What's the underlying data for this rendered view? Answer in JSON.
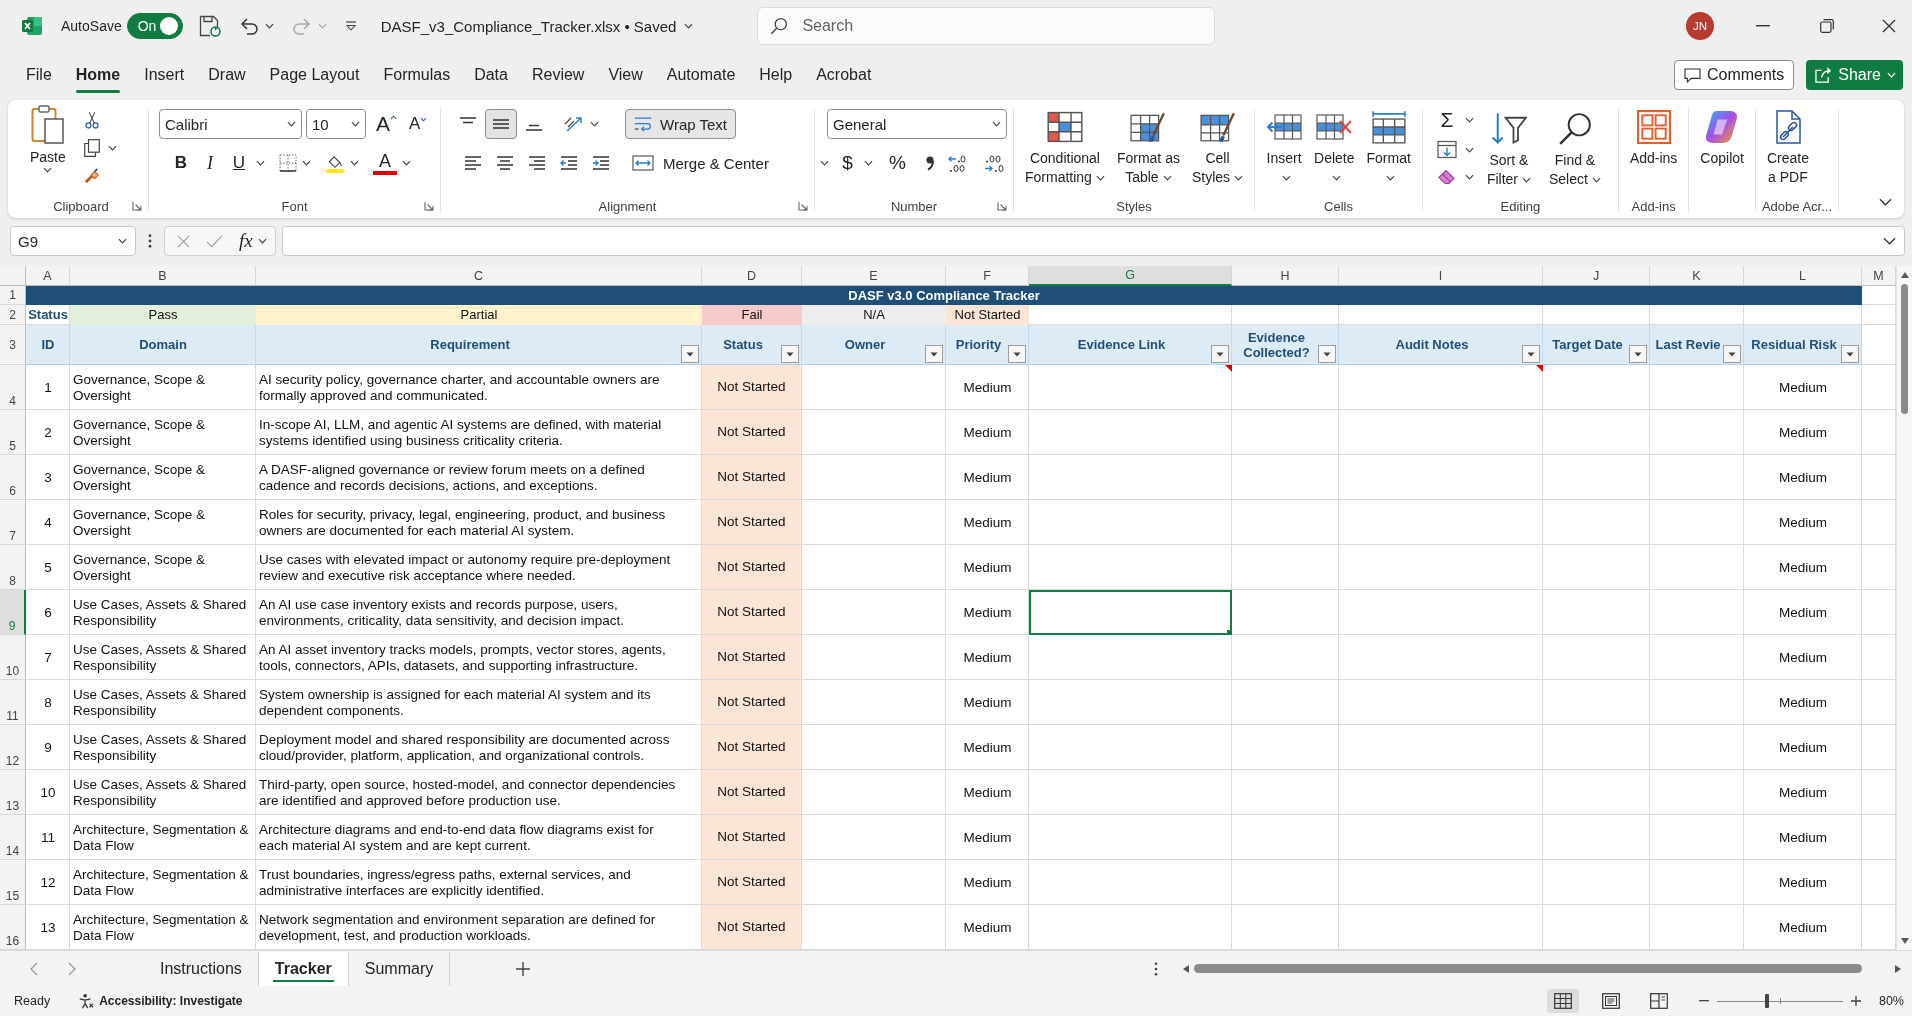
{
  "title_bar": {
    "autosave": {
      "label": "AutoSave",
      "toggle_label": "On",
      "on": true
    },
    "undo": {
      "disabled": false
    },
    "redo": {
      "disabled": true
    },
    "document_title": "DASF_v3_Compliance_Tracker.xlsx • Saved",
    "search": {
      "placeholder": "Search"
    },
    "account_initials": "JN"
  },
  "menu_tabs": [
    {
      "label": "File",
      "selected": false
    },
    {
      "label": "Home",
      "selected": true
    },
    {
      "label": "Insert",
      "selected": false
    },
    {
      "label": "Draw",
      "selected": false
    },
    {
      "label": "Page Layout",
      "selected": false
    },
    {
      "label": "Formulas",
      "selected": false
    },
    {
      "label": "Data",
      "selected": false
    },
    {
      "label": "Review",
      "selected": false
    },
    {
      "label": "View",
      "selected": false
    },
    {
      "label": "Automate",
      "selected": false
    },
    {
      "label": "Help",
      "selected": false
    },
    {
      "label": "Acrobat",
      "selected": false
    }
  ],
  "comments_button": "Comments",
  "share_button": "Share",
  "ribbon": {
    "groups": [
      {
        "kind": "clipboard",
        "label": "Clipboard",
        "paste": "Paste"
      },
      {
        "kind": "font",
        "label": "Font",
        "font_name": "Calibri",
        "font_size": "10",
        "grow_font": "A",
        "shrink_font": "A",
        "bold": "B",
        "italic": "I",
        "underline": "U",
        "font_color": "A"
      },
      {
        "kind": "alignment",
        "label": "Alignment",
        "vertical_align": [
          {
            "kind": "top",
            "selected": false
          },
          {
            "kind": "middle",
            "selected": true
          },
          {
            "kind": "bottom",
            "selected": false
          }
        ],
        "wrap_text": {
          "label": "Wrap Text",
          "on": true
        },
        "merge": "Merge & Center"
      },
      {
        "kind": "number",
        "label": "Number",
        "format": "General",
        "currency": "$",
        "percent": "%"
      },
      {
        "kind": "buttons",
        "label": "Styles",
        "buttons": [
          {
            "kind": "conditional_formatting",
            "label": [
              "Conditional",
              "Formatting"
            ],
            "dropdown": true
          },
          {
            "kind": "format_as_table",
            "label": [
              "Format as",
              "Table"
            ],
            "dropdown": true
          },
          {
            "kind": "cell_styles",
            "label": [
              "Cell",
              "Styles"
            ],
            "dropdown": true
          }
        ]
      },
      {
        "kind": "buttons",
        "label": "Cells",
        "buttons": [
          {
            "kind": "insert",
            "label": [
              "Insert"
            ],
            "dropdown": true
          },
          {
            "kind": "delete",
            "label": [
              "Delete"
            ],
            "dropdown": true
          },
          {
            "kind": "format",
            "label": [
              "Format"
            ],
            "dropdown": true
          }
        ]
      },
      {
        "kind": "editing",
        "label": "Editing",
        "autosum": "Σ",
        "buttons": [
          {
            "kind": "sort_filter",
            "label": [
              "Sort &",
              "Filter"
            ],
            "dropdown": true
          },
          {
            "kind": "find_select",
            "label": [
              "Find &",
              "Select"
            ],
            "dropdown": true
          }
        ]
      },
      {
        "kind": "buttons",
        "label": "Add-ins",
        "buttons": [
          {
            "kind": "add_ins",
            "label": [
              "Add-ins"
            ],
            "dropdown": false
          }
        ]
      },
      {
        "kind": "buttons",
        "buttons": [
          {
            "kind": "copilot",
            "label": [
              "Copilot"
            ],
            "dropdown": false
          }
        ]
      },
      {
        "kind": "buttons",
        "label": "Adobe Acr...",
        "buttons": [
          {
            "kind": "create_pdf",
            "label": [
              "Create",
              "a PDF"
            ],
            "dropdown": false
          }
        ]
      }
    ]
  },
  "formula_bar": {
    "name_box": "G9",
    "function_button": "fx"
  },
  "table": {
    "columns": [
      {
        "letter": "A",
        "heading": "ID",
        "filter": false,
        "selected": false
      },
      {
        "letter": "B",
        "heading": "Domain",
        "filter": false,
        "selected": false
      },
      {
        "letter": "C",
        "heading": "Requirement",
        "filter": true,
        "selected": false
      },
      {
        "letter": "D",
        "heading": "Status",
        "filter": true,
        "selected": false
      },
      {
        "letter": "E",
        "heading": "Owner",
        "filter": true,
        "selected": false
      },
      {
        "letter": "F",
        "heading": "Priority",
        "filter": true,
        "selected": false
      },
      {
        "letter": "G",
        "heading": "Evidence Link",
        "filter": true,
        "selected": true
      },
      {
        "letter": "H",
        "heading": "Evidence Collected?",
        "filter": true,
        "selected": false
      },
      {
        "letter": "I",
        "heading": "Audit Notes",
        "filter": true,
        "selected": false
      },
      {
        "letter": "J",
        "heading": "Target Date",
        "filter": true,
        "selected": false
      },
      {
        "letter": "K",
        "heading": "Last Revie",
        "filter": true,
        "selected": false
      },
      {
        "letter": "L",
        "heading": "Residual Risk",
        "filter": true,
        "selected": false
      },
      {
        "letter": "M",
        "selected": false
      }
    ],
    "title": {
      "row_number": "1",
      "text": "DASF v3.0 Compliance Tracker"
    },
    "legend": {
      "row_number": "2",
      "label": "Status",
      "items": [
        {
          "label": "Pass",
          "color": "#e2efda"
        },
        {
          "label": "Partial",
          "color": "#fff2cc"
        },
        {
          "label": "Fail",
          "color": "#f8cbcb"
        },
        {
          "label": "N/A",
          "color": "#ededed"
        },
        {
          "label": "Not Started",
          "color": "#fce4d6"
        }
      ]
    },
    "header_row_number": "3",
    "rows": [
      {
        "row_number": "4",
        "selected": false,
        "id": "1",
        "domain": "Governance, Scope & Oversight",
        "requirement": "AI security policy, governance charter, and accountable owners are formally approved and communicated.",
        "status": "Not Started",
        "priority": "Medium",
        "residual_risk": "Medium",
        "evidence_link_note": true,
        "audit_notes_note": true
      },
      {
        "row_number": "5",
        "selected": false,
        "id": "2",
        "domain": "Governance, Scope & Oversight",
        "requirement": "In-scope AI, LLM, and agentic AI systems are defined, with material systems identified using business criticality criteria.",
        "status": "Not Started",
        "priority": "Medium",
        "residual_risk": "Medium",
        "evidence_link_note": false,
        "audit_notes_note": false
      },
      {
        "row_number": "6",
        "selected": false,
        "id": "3",
        "domain": "Governance, Scope & Oversight",
        "requirement": "A DASF-aligned governance or review forum meets on a defined cadence and records decisions, actions, and exceptions.",
        "status": "Not Started",
        "priority": "Medium",
        "residual_risk": "Medium",
        "evidence_link_note": false,
        "audit_notes_note": false
      },
      {
        "row_number": "7",
        "selected": false,
        "id": "4",
        "domain": "Governance, Scope & Oversight",
        "requirement": "Roles for security, privacy, legal, engineering, product, and business owners are documented for each material AI system.",
        "status": "Not Started",
        "priority": "Medium",
        "residual_risk": "Medium",
        "evidence_link_note": false,
        "audit_notes_note": false
      },
      {
        "row_number": "8",
        "selected": false,
        "id": "5",
        "domain": "Governance, Scope & Oversight",
        "requirement": "Use cases with elevated impact or autonomy require pre-deployment review and executive risk acceptance where needed.",
        "status": "Not Started",
        "priority": "Medium",
        "residual_risk": "Medium",
        "evidence_link_note": false,
        "audit_notes_note": false
      },
      {
        "row_number": "9",
        "selected": true,
        "id": "6",
        "domain": "Use Cases, Assets & Shared Responsibility",
        "requirement": "An AI use case inventory exists and records purpose, users, environments, criticality, data sensitivity, and decision impact.",
        "status": "Not Started",
        "priority": "Medium",
        "residual_risk": "Medium",
        "evidence_link_note": false,
        "audit_notes_note": false
      },
      {
        "row_number": "10",
        "selected": false,
        "id": "7",
        "domain": "Use Cases, Assets & Shared Responsibility",
        "requirement": "An AI asset inventory tracks models, prompts, vector stores, agents, tools, connectors, APIs, datasets, and supporting infrastructure.",
        "status": "Not Started",
        "priority": "Medium",
        "residual_risk": "Medium",
        "evidence_link_note": false,
        "audit_notes_note": false
      },
      {
        "row_number": "11",
        "selected": false,
        "id": "8",
        "domain": "Use Cases, Assets & Shared Responsibility",
        "requirement": "System ownership is assigned for each material AI system and its dependent components.",
        "status": "Not Started",
        "priority": "Medium",
        "residual_risk": "Medium",
        "evidence_link_note": false,
        "audit_notes_note": false
      },
      {
        "row_number": "12",
        "selected": false,
        "id": "9",
        "domain": "Use Cases, Assets & Shared Responsibility",
        "requirement": "Deployment model and shared responsibility are documented across cloud/provider, platform, application, and organizational controls.",
        "status": "Not Started",
        "priority": "Medium",
        "residual_risk": "Medium",
        "evidence_link_note": false,
        "audit_notes_note": false
      },
      {
        "row_number": "13",
        "selected": false,
        "id": "10",
        "domain": "Use Cases, Assets & Shared Responsibility",
        "requirement": "Third-party, open source, hosted-model, and connector dependencies are identified and approved before production use.",
        "status": "Not Started",
        "priority": "Medium",
        "residual_risk": "Medium",
        "evidence_link_note": false,
        "audit_notes_note": false
      },
      {
        "row_number": "14",
        "selected": false,
        "id": "11",
        "domain": "Architecture, Segmentation & Data Flow",
        "requirement": "Architecture diagrams and end-to-end data flow diagrams exist for each material AI system and are kept current.",
        "status": "Not Started",
        "priority": "Medium",
        "residual_risk": "Medium",
        "evidence_link_note": false,
        "audit_notes_note": false
      },
      {
        "row_number": "15",
        "selected": false,
        "id": "12",
        "domain": "Architecture, Segmentation & Data Flow",
        "requirement": "Trust boundaries, ingress/egress paths, external services, and administrative interfaces are explicitly identified.",
        "status": "Not Started",
        "priority": "Medium",
        "residual_risk": "Medium",
        "evidence_link_note": false,
        "audit_notes_note": false
      },
      {
        "row_number": "16",
        "selected": false,
        "id": "13",
        "domain": "Architecture, Segmentation & Data Flow",
        "requirement": "Network segmentation and environment separation are defined for development, test, and production workloads.",
        "status": "Not Started",
        "priority": "Medium",
        "residual_risk": "Medium",
        "evidence_link_note": false,
        "audit_notes_note": false
      }
    ]
  },
  "sheet_tabs": [
    {
      "label": "Instructions",
      "selected": false
    },
    {
      "label": "Tracker",
      "selected": true
    },
    {
      "label": "Summary",
      "selected": false
    }
  ],
  "status_bar": {
    "status": "Ready",
    "accessibility": "Accessibility: Investigate",
    "views": [
      {
        "kind": "normal",
        "selected": true
      },
      {
        "kind": "page_layout",
        "selected": false
      },
      {
        "kind": "page_break",
        "selected": false
      }
    ],
    "zoom": {
      "level": 0.4,
      "percent": "80%"
    }
  }
}
